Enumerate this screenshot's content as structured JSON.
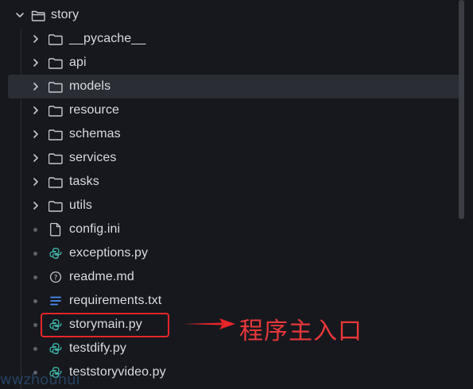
{
  "explorer": {
    "root": {
      "label": "story",
      "expanded": true,
      "icon": "folder-open-icon"
    },
    "folders": [
      {
        "label": "__pycache__",
        "icon": "folder-icon"
      },
      {
        "label": "api",
        "icon": "folder-icon"
      },
      {
        "label": "models",
        "icon": "folder-icon",
        "hovered": true
      },
      {
        "label": "resource",
        "icon": "folder-icon"
      },
      {
        "label": "schemas",
        "icon": "folder-icon"
      },
      {
        "label": "services",
        "icon": "folder-icon"
      },
      {
        "label": "tasks",
        "icon": "folder-icon"
      },
      {
        "label": "utils",
        "icon": "folder-icon"
      }
    ],
    "files": [
      {
        "label": "config.ini",
        "icon": "file-icon"
      },
      {
        "label": "exceptions.py",
        "icon": "python-icon"
      },
      {
        "label": "readme.md",
        "icon": "info-icon"
      },
      {
        "label": "requirements.txt",
        "icon": "text-lines-icon"
      },
      {
        "label": "storymain.py",
        "icon": "python-icon"
      },
      {
        "label": "testdify.py",
        "icon": "python-icon"
      },
      {
        "label": "teststoryvideo.py",
        "icon": "python-icon"
      }
    ]
  },
  "annotation": {
    "text": "程序主入口",
    "color": "#e8373a"
  },
  "watermark": {
    "text": "wwzhouhui"
  },
  "colors": {
    "background": "#16181d",
    "hover_row": "#2a2d33",
    "python_icon": "#3fb7a8",
    "requirements_icon": "#4a8cf0",
    "highlight": "#e5262a"
  }
}
